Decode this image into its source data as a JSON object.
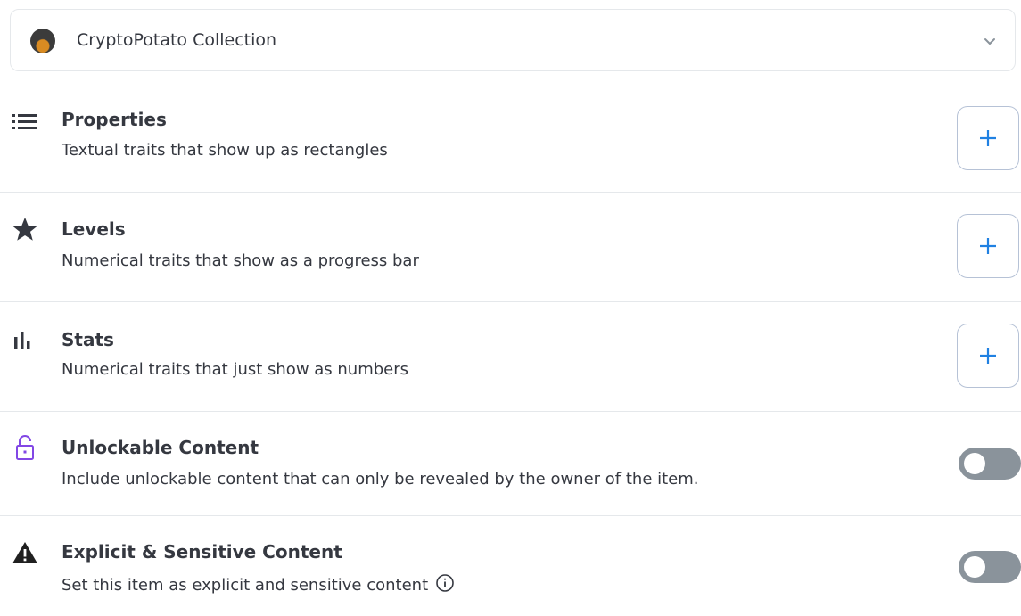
{
  "collection": {
    "label": "CryptoPotato Collection",
    "avatar_icon": "potato-avatar",
    "chevron_icon": "chevron-down-icon"
  },
  "sections": {
    "properties": {
      "icon": "list-icon",
      "title": "Properties",
      "description": "Textual traits that show up as rectangles",
      "action": "+"
    },
    "levels": {
      "icon": "star-icon",
      "title": "Levels",
      "description": "Numerical traits that show as a progress bar",
      "action": "+"
    },
    "stats": {
      "icon": "bar-chart-icon",
      "title": "Stats",
      "description": "Numerical traits that just show as numbers",
      "action": "+"
    },
    "unlockable": {
      "icon": "lock-icon",
      "title": "Unlockable Content",
      "description": "Include unlockable content that can only be revealed by the owner of the item.",
      "toggle_on": false
    },
    "explicit": {
      "icon": "warning-icon",
      "title": "Explicit & Sensitive Content",
      "description": "Set this item as explicit and sensitive content",
      "info_icon": "info-icon",
      "toggle_on": false
    }
  },
  "colors": {
    "accent": "#2081e2",
    "text": "#353840",
    "border": "#e5e8eb",
    "toggle_off": "#8a939b",
    "lock_icon": "#8247e5"
  }
}
